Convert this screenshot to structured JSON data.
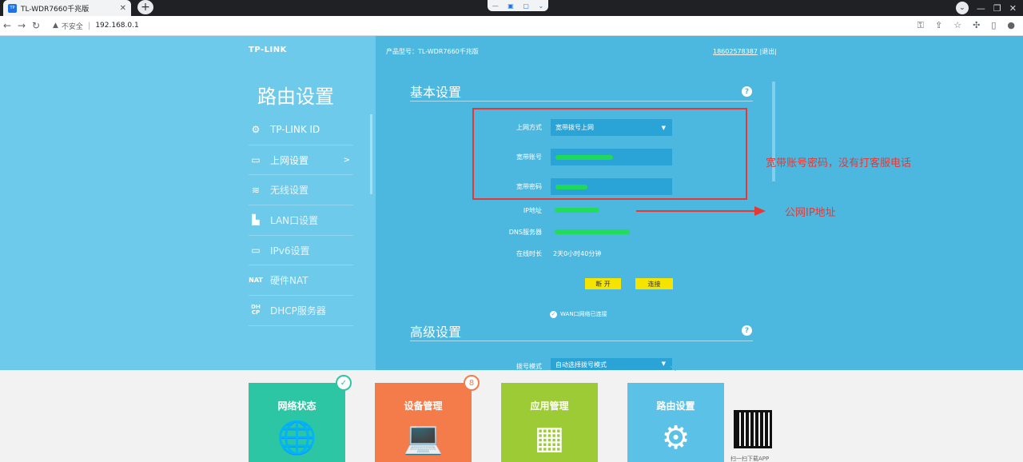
{
  "browser": {
    "tab_title": "TL-WDR7660千兆版",
    "tab_favicon": "TP",
    "url_security": "不安全",
    "url": "192.168.0.1"
  },
  "header": {
    "logo": "TP-LINK",
    "product_model": "产品型号：TL-WDR7660千兆版",
    "account": "18602578387",
    "logout": "|退出|"
  },
  "sidebar": {
    "title": "路由设置",
    "items": [
      {
        "label": "TP-LINK ID",
        "icon": "gear-icon"
      },
      {
        "label": "上网设置",
        "icon": "laptop-icon",
        "arrow": ">"
      },
      {
        "label": "无线设置",
        "icon": "wifi-icon"
      },
      {
        "label": "LAN口设置",
        "icon": "lan-icon"
      },
      {
        "label": "IPv6设置",
        "icon": "laptop-icon"
      },
      {
        "label": "硬件NAT",
        "icon": "nat-icon"
      },
      {
        "label": "DHCP服务器",
        "icon": "dhcp-icon"
      }
    ]
  },
  "basic": {
    "title": "基本设置",
    "help": "?",
    "conn_type_label": "上网方式",
    "conn_type_value": "宽带拨号上网",
    "account_label": "宽带账号",
    "password_label": "宽带密码",
    "ip_label": "IP地址",
    "dns_label": "DNS服务器",
    "online_label": "在线时长",
    "online_value": "2天0小时40分钟",
    "disconnect": "断 开",
    "connect": "连接",
    "wan_status": "WAN口网络已连接"
  },
  "advanced": {
    "title": "高级设置",
    "help": "?",
    "dial_mode_label": "拨号模式",
    "dial_mode_value": "自动选择拨号模式"
  },
  "annotations": {
    "box_note": "宽带账号密码，没有打客服电话",
    "arrow_note": "公网IP地址"
  },
  "tiles": [
    {
      "label": "网络状态",
      "color": "#2cc6a4",
      "badge": "✓"
    },
    {
      "label": "设备管理",
      "color": "#f47c4a",
      "badge": "8"
    },
    {
      "label": "应用管理",
      "color": "#9ccb35"
    },
    {
      "label": "路由设置",
      "color": "#5bc1e6"
    }
  ],
  "qr_caption": "扫一扫下载APP",
  "colors": {
    "accent": "#4cb8e0",
    "annotation": "#e53935",
    "button": "#f5e400"
  }
}
